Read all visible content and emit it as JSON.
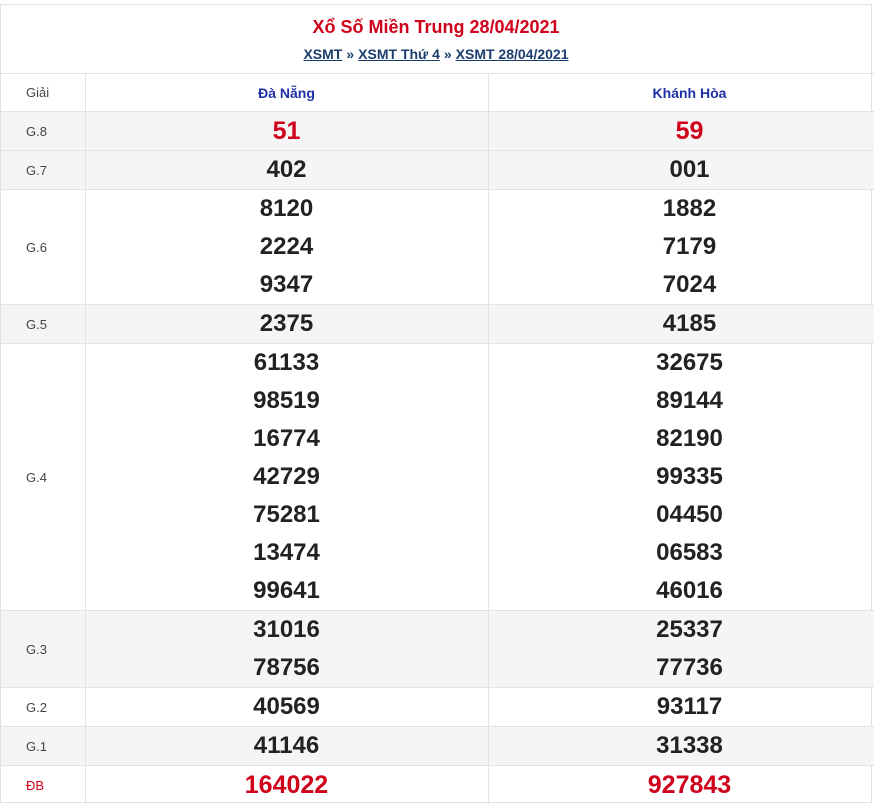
{
  "header": {
    "title": "Xổ Số Miền Trung 28/04/2021",
    "breadcrumb": [
      "XSMT",
      "XSMT Thứ 4",
      "XSMT 28/04/2021"
    ],
    "separator": "»"
  },
  "table": {
    "label_header": "Giải",
    "provinces": [
      "Đà Nẵng",
      "Khánh Hòa"
    ],
    "rows": [
      {
        "label": "G.8",
        "alt": true,
        "highlight": true,
        "values": [
          [
            "51"
          ],
          [
            "59"
          ]
        ]
      },
      {
        "label": "G.7",
        "alt": true,
        "highlight": false,
        "values": [
          [
            "402"
          ],
          [
            "001"
          ]
        ]
      },
      {
        "label": "G.6",
        "alt": false,
        "highlight": false,
        "values": [
          [
            "8120",
            "2224",
            "9347"
          ],
          [
            "1882",
            "7179",
            "7024"
          ]
        ]
      },
      {
        "label": "G.5",
        "alt": true,
        "highlight": false,
        "values": [
          [
            "2375"
          ],
          [
            "4185"
          ]
        ]
      },
      {
        "label": "G.4",
        "alt": false,
        "highlight": false,
        "values": [
          [
            "61133",
            "98519",
            "16774",
            "42729",
            "75281",
            "13474",
            "99641"
          ],
          [
            "32675",
            "89144",
            "82190",
            "99335",
            "04450",
            "06583",
            "46016"
          ]
        ]
      },
      {
        "label": "G.3",
        "alt": true,
        "highlight": false,
        "values": [
          [
            "31016",
            "78756"
          ],
          [
            "25337",
            "77736"
          ]
        ]
      },
      {
        "label": "G.2",
        "alt": false,
        "highlight": false,
        "values": [
          [
            "40569"
          ],
          [
            "93117"
          ]
        ]
      },
      {
        "label": "G.1",
        "alt": true,
        "highlight": false,
        "values": [
          [
            "41146"
          ],
          [
            "31338"
          ]
        ]
      },
      {
        "label": "ĐB",
        "alt": false,
        "highlight": true,
        "values": [
          [
            "164022"
          ],
          [
            "927843"
          ]
        ]
      }
    ]
  },
  "colors": {
    "title_red": "#d0021b",
    "link_blue": "#1a3d6d",
    "province_blue": "#1f2fa6",
    "row_alt_bg": "#f5f5f5"
  }
}
